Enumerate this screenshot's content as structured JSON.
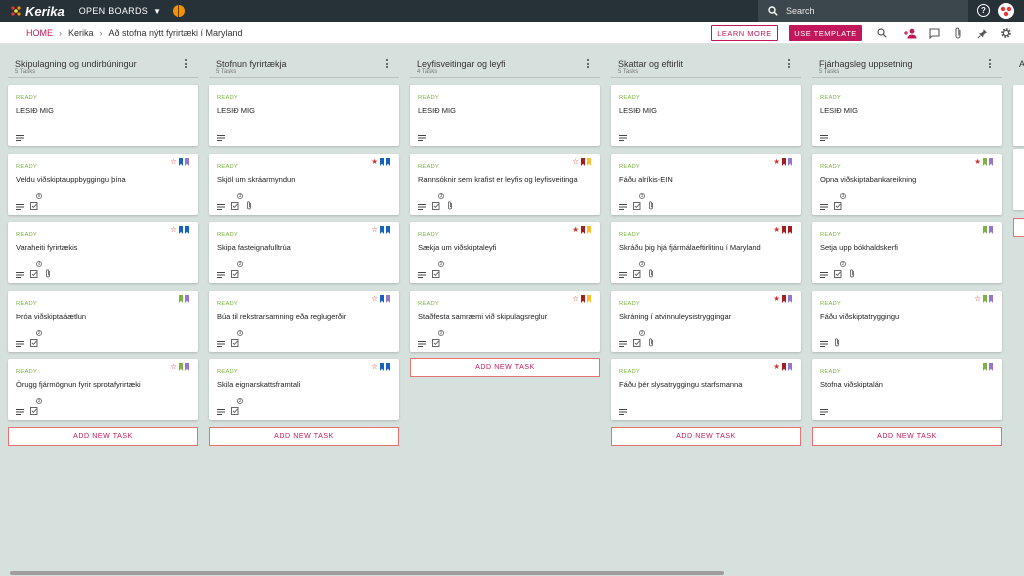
{
  "app": {
    "logo_text": "Kerika",
    "open_boards_label": "OPEN BOARDS",
    "search_placeholder": "Search"
  },
  "breadcrumb": {
    "home": "HOME",
    "workspace": "Kerika",
    "board": "Að stofna nýtt fyrirtæki í Maryland"
  },
  "buttons": {
    "learn_more": "LEARN MORE",
    "use_template": "USE TEMPLATE"
  },
  "colors": {
    "brand": "#c2185b",
    "ready": "#7cb342",
    "topbar": "#263238",
    "board_bg": "#d6e0dc",
    "tag_blue": "#1565c0",
    "tag_purple": "#9575cd",
    "tag_green": "#7cb342",
    "tag_darkred": "#a61e1e",
    "tag_yellow": "#fbc02d",
    "star": "#d32f2f"
  },
  "add_task_label": "ADD NEW TASK",
  "columns": [
    {
      "title": "Skipulagning og undirbúningur",
      "count": "5 Tasks",
      "cards": [
        {
          "status": "READY",
          "name": "LESIÐ MIG",
          "star": "none",
          "tags": [],
          "checklist": false,
          "attach": false
        },
        {
          "status": "READY",
          "name": "Veldu viðskiptauppbyggingu þína",
          "star": "outline",
          "tags": [
            "blue",
            "purple"
          ],
          "checklist": true,
          "checklist_count": "6",
          "attach": false
        },
        {
          "status": "READY",
          "name": "Varaheiti fyrirtækis",
          "star": "outline",
          "tags": [
            "blue",
            "blue"
          ],
          "checklist": true,
          "checklist_count": "4",
          "attach": true
        },
        {
          "status": "READY",
          "name": "Þróa viðskiptaáætlun",
          "star": "none",
          "tags": [
            "green",
            "purple"
          ],
          "checklist": true,
          "checklist_count": "2",
          "attach": false
        },
        {
          "status": "READY",
          "name": "Örugg fjármögnun fyrir sprotafyrirtæki",
          "star": "outline",
          "tags": [
            "green",
            "purple"
          ],
          "checklist": true,
          "checklist_count": "3",
          "attach": false
        }
      ]
    },
    {
      "title": "Stofnun fyrirtækja",
      "count": "5 Tasks",
      "cards": [
        {
          "status": "READY",
          "name": "LESIÐ MIG",
          "star": "none",
          "tags": [],
          "checklist": false,
          "attach": false
        },
        {
          "status": "READY",
          "name": "Skjöl um skráarmyndun",
          "star": "filled",
          "tags": [
            "blue",
            "blue"
          ],
          "checklist": true,
          "checklist_count": "3",
          "attach": true
        },
        {
          "status": "READY",
          "name": "Skipa fasteignafulltrúa",
          "star": "outline",
          "tags": [
            "blue",
            "blue"
          ],
          "checklist": true,
          "checklist_count": "2",
          "attach": false
        },
        {
          "status": "READY",
          "name": "Búa til rekstrarsamning eða reglugerðir",
          "star": "outline",
          "tags": [
            "blue",
            "purple"
          ],
          "checklist": true,
          "checklist_count": "3",
          "attach": false
        },
        {
          "status": "READY",
          "name": "Skila eignarskattsframtali",
          "star": "outline",
          "tags": [
            "blue",
            "blue"
          ],
          "checklist": true,
          "checklist_count": "2",
          "attach": false
        }
      ]
    },
    {
      "title": "Leyfisveitingar og leyfi",
      "count": "4 Tasks",
      "cards": [
        {
          "status": "READY",
          "name": "LESIÐ MIG",
          "star": "none",
          "tags": [],
          "checklist": false,
          "attach": false
        },
        {
          "status": "READY",
          "name": "Rannsóknir sem krafist er leyfis og leyfisveitinga",
          "star": "outline",
          "tags": [
            "darkred",
            "yellow"
          ],
          "checklist": true,
          "checklist_count": "3",
          "attach": true
        },
        {
          "status": "READY",
          "name": "Sækja um viðskiptaleyfi",
          "star": "filled",
          "tags": [
            "darkred",
            "yellow"
          ],
          "checklist": true,
          "checklist_count": "2",
          "attach": false
        },
        {
          "status": "READY",
          "name": "Staðfesta samræmi við skipulagsreglur",
          "star": "outline",
          "tags": [
            "darkred",
            "yellow"
          ],
          "checklist": true,
          "checklist_count": "2",
          "attach": false
        }
      ]
    },
    {
      "title": "Skattar og eftirlit",
      "count": "5 Tasks",
      "cards": [
        {
          "status": "READY",
          "name": "LESIÐ MIG",
          "star": "none",
          "tags": [],
          "checklist": false,
          "attach": false
        },
        {
          "status": "READY",
          "name": "Fáðu alríkis-EIN",
          "star": "filled",
          "tags": [
            "darkred",
            "purple"
          ],
          "checklist": true,
          "checklist_count": "3",
          "attach": true
        },
        {
          "status": "READY",
          "name": "Skráðu þig hjá fjármálaeftirlitinu í Maryland",
          "star": "filled",
          "tags": [
            "darkred",
            "darkred"
          ],
          "checklist": true,
          "checklist_count": "3",
          "attach": true
        },
        {
          "status": "READY",
          "name": "Skráning í atvinnuleysistryggingar",
          "star": "filled",
          "tags": [
            "darkred",
            "purple"
          ],
          "checklist": true,
          "checklist_count": "2",
          "attach": true
        },
        {
          "status": "READY",
          "name": "Fáðu þér slysatryggingu starfsmanna",
          "star": "filled",
          "tags": [
            "darkred",
            "purple"
          ],
          "checklist": false,
          "attach": false
        }
      ]
    },
    {
      "title": "Fjárhagsleg uppsetning",
      "count": "5 Tasks",
      "cards": [
        {
          "status": "READY",
          "name": "LESIÐ MIG",
          "star": "none",
          "tags": [],
          "checklist": false,
          "attach": false
        },
        {
          "status": "READY",
          "name": "Opna viðskiptabankareikning",
          "star": "filled",
          "tags": [
            "green",
            "purple"
          ],
          "checklist": true,
          "checklist_count": "3",
          "attach": false
        },
        {
          "status": "READY",
          "name": "Setja upp bókhaldskerfi",
          "star": "none",
          "tags": [
            "green",
            "purple"
          ],
          "checklist": true,
          "checklist_count": "2",
          "attach": true
        },
        {
          "status": "READY",
          "name": "Fáðu viðskiptatryggingu",
          "star": "outline",
          "tags": [
            "green",
            "purple"
          ],
          "checklist": false,
          "attach": true
        },
        {
          "status": "READY",
          "name": "Stofna viðskiptalán",
          "star": "none",
          "tags": [
            "green",
            "purple"
          ],
          "checklist": false,
          "attach": false
        }
      ]
    }
  ]
}
